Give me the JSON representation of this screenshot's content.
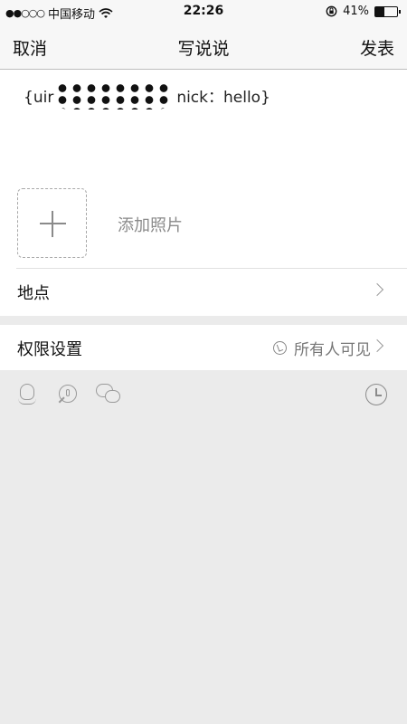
{
  "status_bar": {
    "signal": "●●○○○",
    "carrier": "中国移动",
    "time": "22:26",
    "battery_percent": "41%",
    "battery_level": 0.41
  },
  "nav": {
    "cancel": "取消",
    "title": "写说说",
    "publish": "发表"
  },
  "compose": {
    "text_before": "{uir",
    "text_after": "nick：hello}",
    "add_photo_label": "添加照片"
  },
  "location": {
    "label": "地点"
  },
  "permissions": {
    "label": "权限设置",
    "value": "所有人可见"
  },
  "toolbar": {
    "icons": [
      "qq-icon",
      "location-pin-icon",
      "wechat-icon",
      "clock-icon"
    ]
  },
  "colors": {
    "background": "#ebebeb",
    "bar": "#f7f7f7",
    "muted_text": "#8a8a8a"
  }
}
